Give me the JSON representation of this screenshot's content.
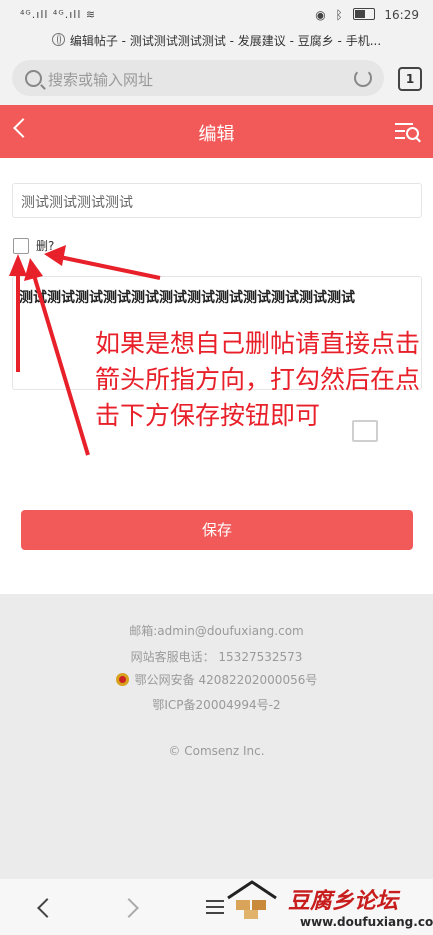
{
  "status_bar": {
    "signal_text": "⁴ᴳ.ıll ⁴ᴳ.ıll ≋",
    "time": "16:29"
  },
  "browser": {
    "page_title": "编辑帖子 - 测试测试测试测试 - 发展建议 - 豆腐乡 - 手机...",
    "url_placeholder": "搜索或输入网址",
    "tab_count": "1"
  },
  "header": {
    "title": "编辑"
  },
  "form": {
    "title_value": "测试测试测试测试",
    "delete_label": "删?",
    "content_value": "测试测试测试测试测试测试测试测试测试测试测试测试",
    "save_label": "保存"
  },
  "annotation": {
    "text": "如果是想自己删帖请直接点击箭头所指方向，打勾然后在点击下方保存按钮即可",
    "color": "#e8202a"
  },
  "footer": {
    "email": "邮箱:admin@doufuxiang.com",
    "phone": "网站客服电话：   15327532573",
    "police_record": "鄂公网安备 42082202000056号",
    "icp": "鄂ICP备20004994号-2",
    "copyright": "© Comsenz Inc."
  },
  "watermark": {
    "name": "豆腐乡论坛",
    "url": "www.doufuxiang.com"
  },
  "colors": {
    "accent": "#f25a5a",
    "footer_bg": "#ebebeb"
  }
}
